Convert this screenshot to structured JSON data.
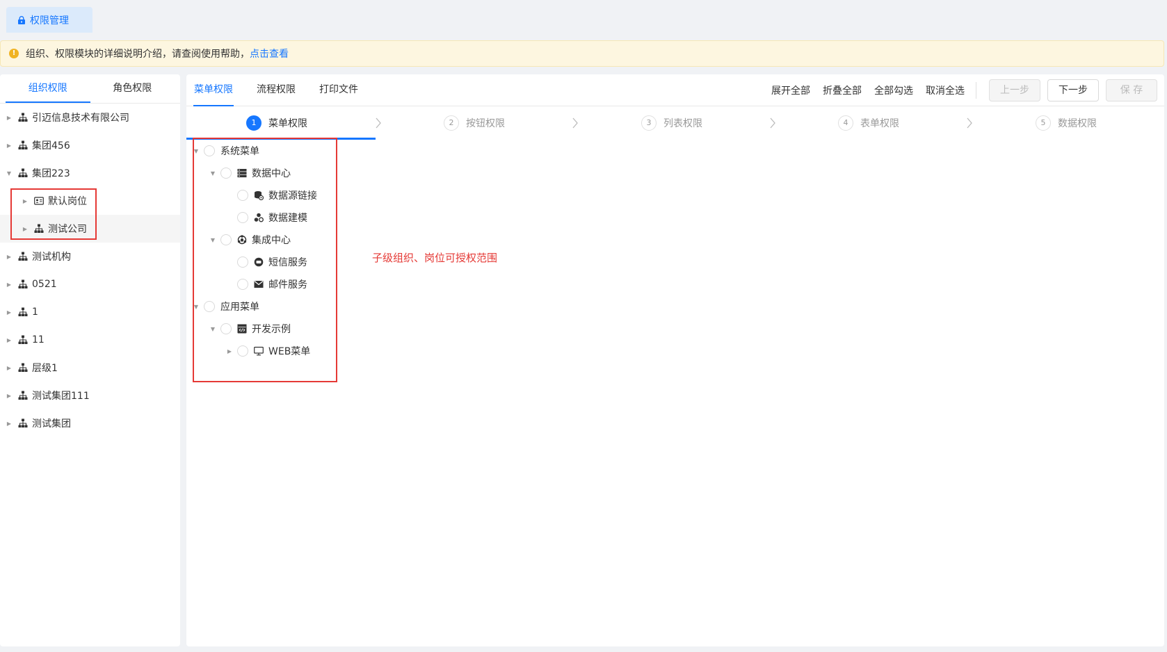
{
  "app_tab": {
    "label": "权限管理"
  },
  "notice": {
    "text": "组织、权限模块的详细说明介绍，请查阅使用帮助，",
    "link": "点击查看"
  },
  "left_tabs": [
    {
      "label": "组织权限",
      "active": true
    },
    {
      "label": "角色权限",
      "active": false
    }
  ],
  "org_tree": [
    {
      "label": "引迈信息技术有限公司",
      "level": 0,
      "expanded": false,
      "icon": "org-icon"
    },
    {
      "label": "集团456",
      "level": 0,
      "expanded": false,
      "icon": "org-icon"
    },
    {
      "label": "集团223",
      "level": 0,
      "expanded": true,
      "icon": "org-icon"
    },
    {
      "label": "默认岗位",
      "level": 1,
      "expanded": false,
      "icon": "position-card-icon"
    },
    {
      "label": "测试公司",
      "level": 1,
      "expanded": false,
      "icon": "org-icon",
      "selected": true
    },
    {
      "label": "测试机构",
      "level": 0,
      "expanded": false,
      "icon": "org-icon"
    },
    {
      "label": "0521",
      "level": 0,
      "expanded": false,
      "icon": "org-icon"
    },
    {
      "label": "1",
      "level": 0,
      "expanded": false,
      "icon": "org-icon"
    },
    {
      "label": "11",
      "level": 0,
      "expanded": false,
      "icon": "org-icon"
    },
    {
      "label": "层级1",
      "level": 0,
      "expanded": false,
      "icon": "org-icon"
    },
    {
      "label": "测试集团111",
      "level": 0,
      "expanded": false,
      "icon": "org-icon"
    },
    {
      "label": "测试集团",
      "level": 0,
      "expanded": false,
      "icon": "org-icon"
    }
  ],
  "right_tabs": [
    {
      "label": "菜单权限",
      "active": true
    },
    {
      "label": "流程权限",
      "active": false
    },
    {
      "label": "打印文件",
      "active": false
    }
  ],
  "actions": {
    "expand_all": "展开全部",
    "collapse_all": "折叠全部",
    "select_all": "全部勾选",
    "deselect_all": "取消全选",
    "prev": "上一步",
    "next": "下一步",
    "save": "保 存"
  },
  "steps": [
    {
      "num": "1",
      "label": "菜单权限",
      "active": true
    },
    {
      "num": "2",
      "label": "按钮权限",
      "active": false
    },
    {
      "num": "3",
      "label": "列表权限",
      "active": false
    },
    {
      "num": "4",
      "label": "表单权限",
      "active": false
    },
    {
      "num": "5",
      "label": "数据权限",
      "active": false
    }
  ],
  "menu_tree": [
    {
      "label": "系统菜单",
      "level": 0,
      "caret": "down",
      "icon": ""
    },
    {
      "label": "数据中心",
      "level": 1,
      "caret": "down",
      "icon": "database-icon"
    },
    {
      "label": "数据源链接",
      "level": 2,
      "caret": "",
      "icon": "datasource-icon"
    },
    {
      "label": "数据建模",
      "level": 2,
      "caret": "",
      "icon": "model-icon"
    },
    {
      "label": "集成中心",
      "level": 1,
      "caret": "down",
      "icon": "integration-icon"
    },
    {
      "label": "短信服务",
      "level": 2,
      "caret": "",
      "icon": "sms-icon"
    },
    {
      "label": "邮件服务",
      "level": 2,
      "caret": "",
      "icon": "mail-icon"
    },
    {
      "label": "应用菜单",
      "level": 0,
      "caret": "down",
      "icon": ""
    },
    {
      "label": "开发示例",
      "level": 1,
      "caret": "down",
      "icon": "code-icon"
    },
    {
      "label": "WEB菜单",
      "level": 2,
      "caret": "right",
      "icon": "monitor-icon"
    }
  ],
  "annotation": "子级组织、岗位可授权范围",
  "colors": {
    "accent": "#1677ff",
    "highlight": "#e53935",
    "notice_bg": "#fdf6e0",
    "warn": "#f0b323"
  }
}
